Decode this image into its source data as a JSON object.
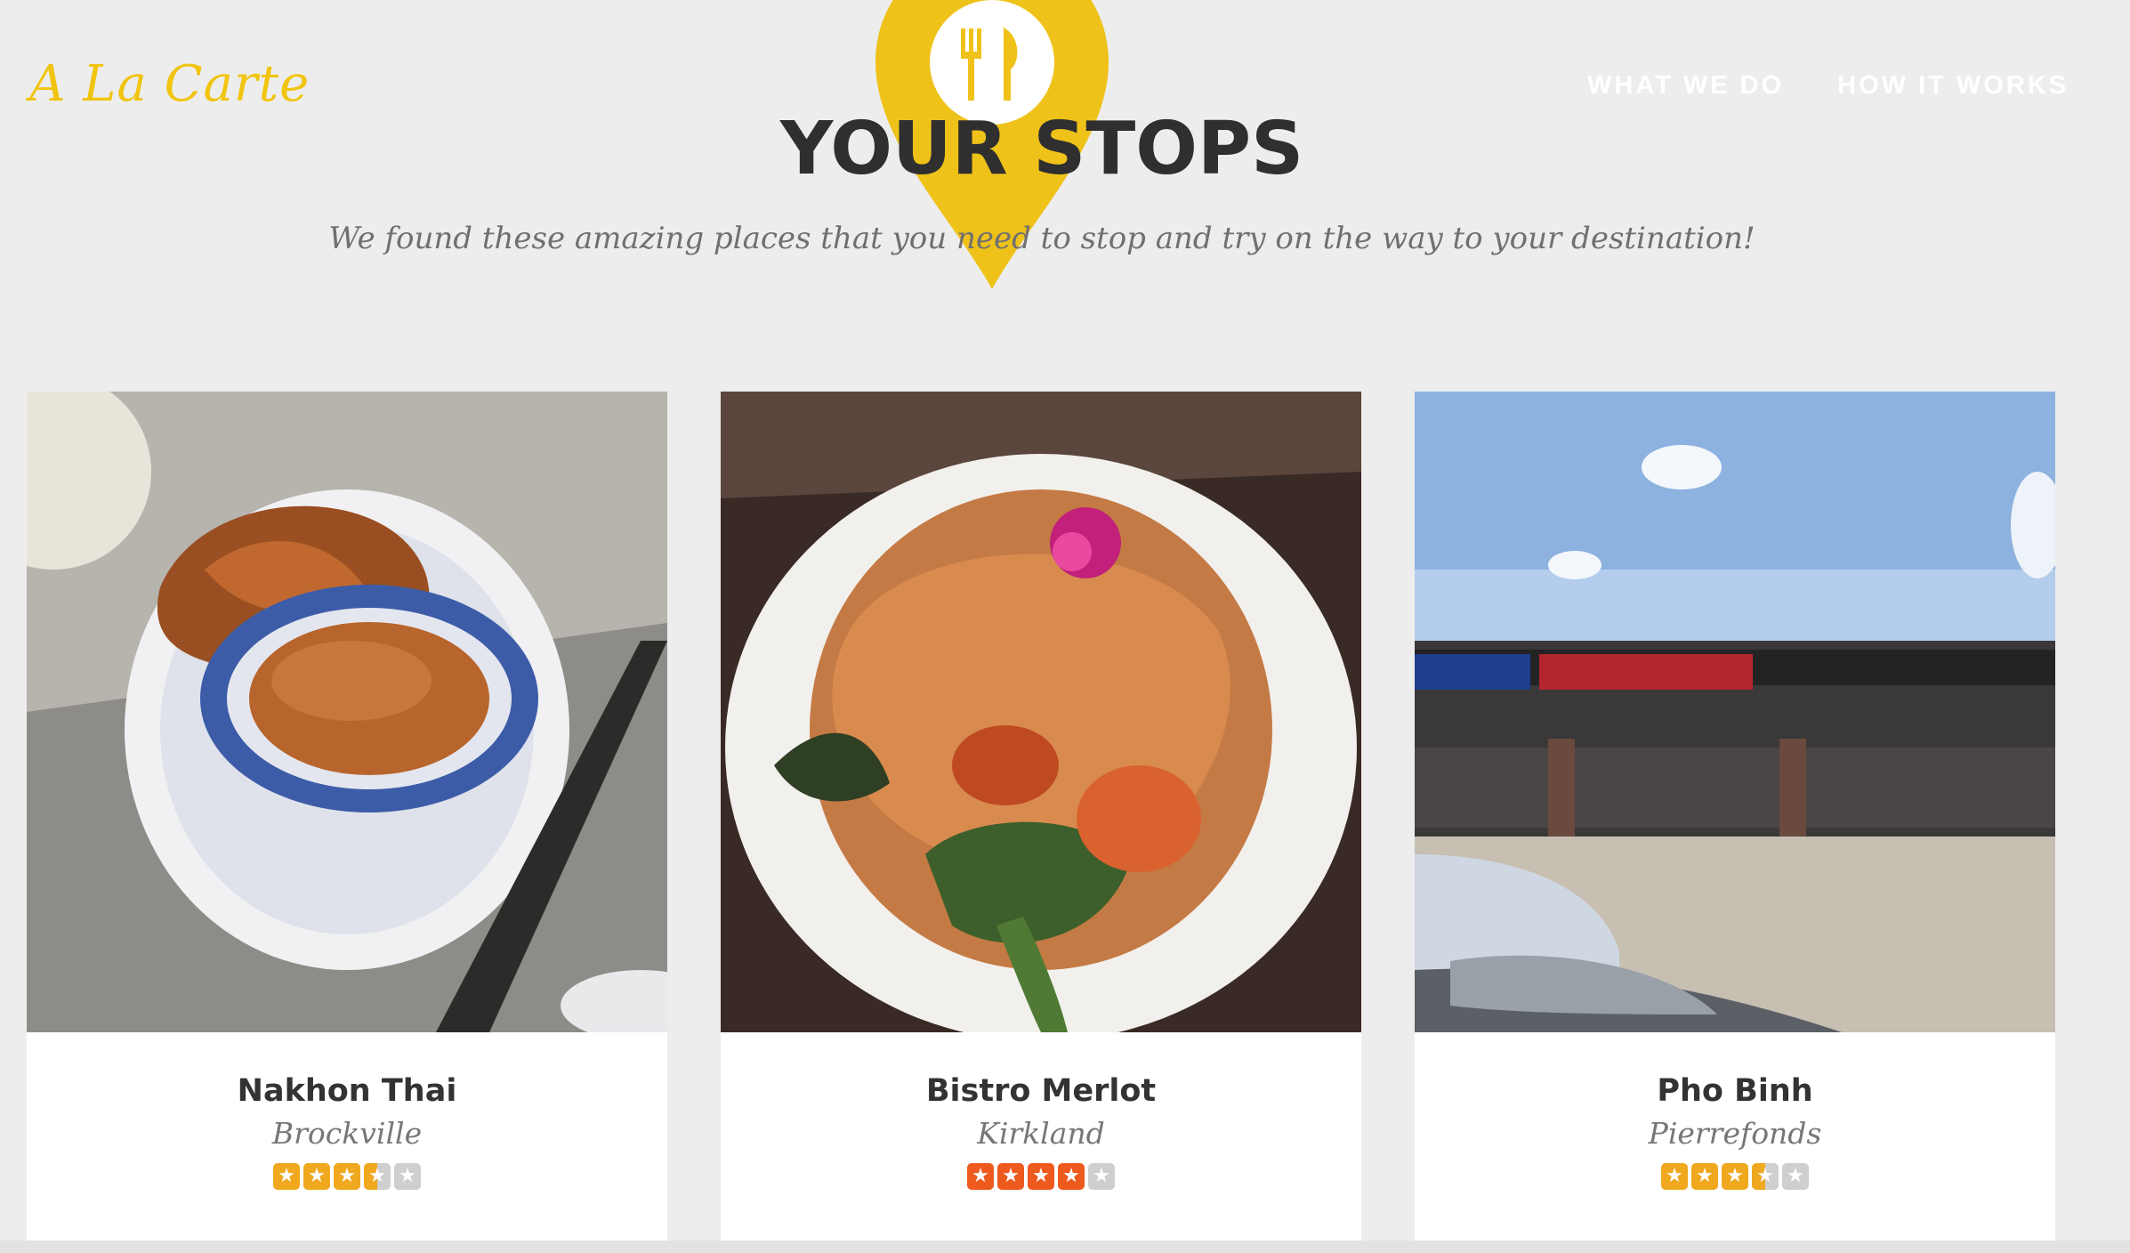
{
  "header": {
    "logo": "A La Carte",
    "nav": [
      "WHAT WE DO",
      "HOW IT WORKS"
    ]
  },
  "hero": {
    "icon": "fork-knife-icon",
    "title": "YOUR STOPS",
    "subtitle": "We found these amazing places that you need to stop and try on the way to your destination!"
  },
  "colors": {
    "accent": "#f1c40f",
    "pin": "#efc21a",
    "rating_gold": "#f0a81f",
    "rating_orange": "#ee5a1e"
  },
  "cards": [
    {
      "name": "Nakhon Thai",
      "city": "Brockville",
      "rating": 3.5,
      "star_color": "#f0a81f"
    },
    {
      "name": "Bistro Merlot",
      "city": "Kirkland",
      "rating": 4,
      "star_color": "#ee5a1e"
    },
    {
      "name": "Pho Binh",
      "city": "Pierrefonds",
      "rating": 3.5,
      "star_color": "#f0a81f"
    }
  ]
}
